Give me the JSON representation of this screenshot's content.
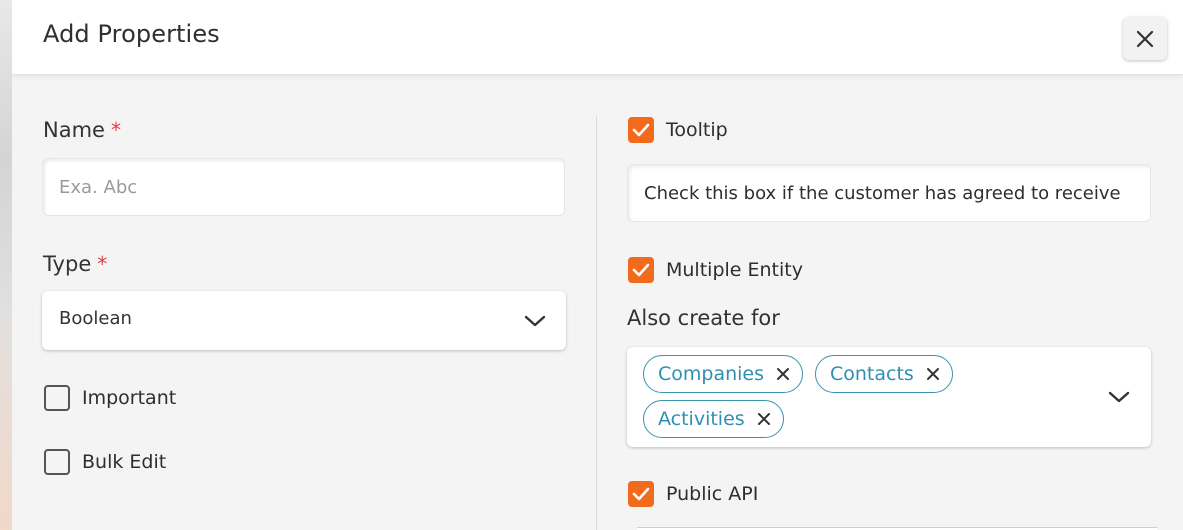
{
  "modal": {
    "title": "Add Properties"
  },
  "name_field": {
    "label": "Name",
    "required_mark": "*",
    "placeholder": "Exa. Abc",
    "value": ""
  },
  "type_field": {
    "label": "Type",
    "required_mark": "*",
    "selected": "Boolean"
  },
  "left_checkboxes": [
    {
      "label": "Important",
      "checked": false
    },
    {
      "label": "Bulk Edit",
      "checked": false
    }
  ],
  "tooltip": {
    "label": "Tooltip",
    "checked": true,
    "value": "Check this box if the customer has agreed to receive"
  },
  "multiple_entity": {
    "label": "Multiple Entity",
    "checked": true
  },
  "also_create_for": {
    "label": "Also create for",
    "chips": [
      "Companies",
      "Contacts",
      "Activities"
    ]
  },
  "public_api": {
    "label": "Public API",
    "checked": true
  },
  "colors": {
    "accent": "#f26a1b",
    "chip": "#2f8fb2",
    "required": "#e0404a"
  }
}
